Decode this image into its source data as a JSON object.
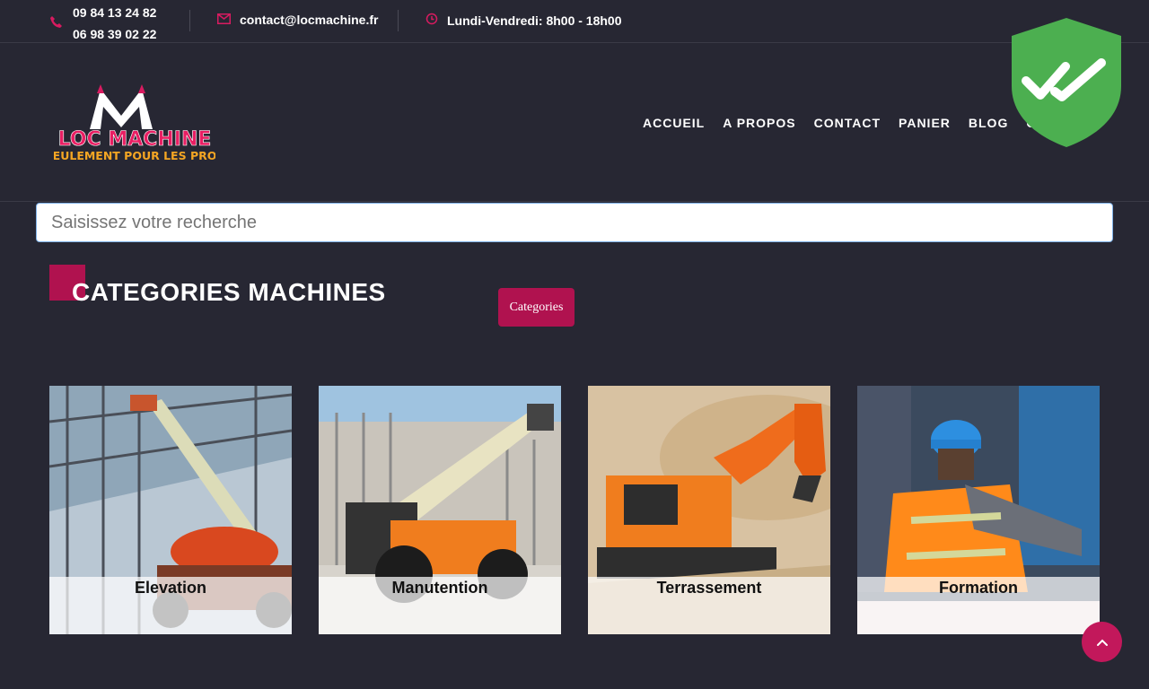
{
  "topbar": {
    "phone_1": "09 84 13 24 82",
    "phone_2": "06 98 39 02 22",
    "email": "contact@locmachine.fr",
    "hours": "Lundi-Vendredi: 8h00 - 18h00",
    "phone_icon": "phone-icon",
    "mail_icon": "envelope-icon",
    "clock_icon": "clock-icon"
  },
  "logo": {
    "line1": "LOC MACHINE",
    "line2": "SEULEMENT POUR LES PROS"
  },
  "nav": {
    "items": [
      "ACCUEIL",
      "A PROPOS",
      "CONTACT",
      "PANIER",
      "BLOG",
      "CO"
    ]
  },
  "search": {
    "placeholder": "Saisissez votre recherche",
    "value": ""
  },
  "section": {
    "title": "CATEGORIES MACHINES",
    "button": "Categories"
  },
  "categories": [
    {
      "label": "Elevation"
    },
    {
      "label": "Manutention"
    },
    {
      "label": "Terrassement"
    },
    {
      "label": "Formation"
    }
  ],
  "colors": {
    "background": "#272733",
    "accent": "#b0124f",
    "shield": "#4caf50"
  }
}
